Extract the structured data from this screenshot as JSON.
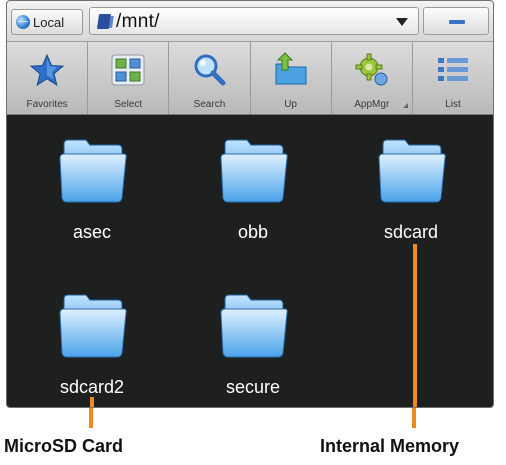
{
  "topbar": {
    "local_label": "Local",
    "path": "/mnt/"
  },
  "toolbar": {
    "items": [
      {
        "label": "Favorites",
        "icon": "star-icon"
      },
      {
        "label": "Select",
        "icon": "select-icon"
      },
      {
        "label": "Search",
        "icon": "search-icon"
      },
      {
        "label": "Up",
        "icon": "up-folder-icon"
      },
      {
        "label": "AppMgr",
        "icon": "gear-icon"
      },
      {
        "label": "List",
        "icon": "list-icon"
      }
    ]
  },
  "folders": [
    {
      "name": "asec"
    },
    {
      "name": "obb"
    },
    {
      "name": "sdcard"
    },
    {
      "name": "sdcard2"
    },
    {
      "name": "secure"
    }
  ],
  "annotations": {
    "microsd": "MicroSD Card",
    "internal": "Internal Memory",
    "color": "#f08a1c"
  }
}
